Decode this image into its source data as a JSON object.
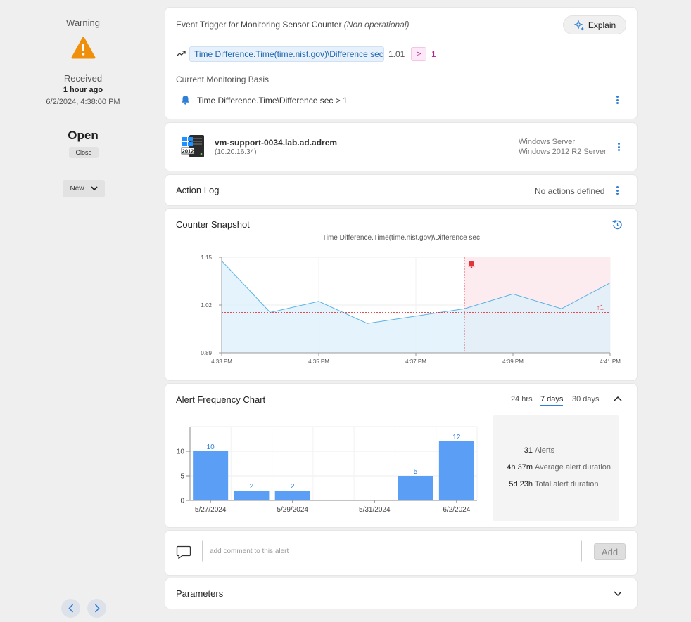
{
  "status": {
    "severity": "Warning",
    "received_label": "Received",
    "received_ago": "1 hour ago",
    "received_datetime": "6/2/2024, 4:38:00 PM",
    "state": "Open",
    "close_label": "Close",
    "new_dropdown": "New"
  },
  "trigger": {
    "title": "Event Trigger for Monitoring Sensor Counter",
    "title_note": "(Non operational)",
    "explain_label": "Explain",
    "counter": "Time Difference.Time(time.nist.gov)\\Difference sec",
    "value": "1.01",
    "operator": ">",
    "threshold": "1",
    "basis_label": "Current Monitoring Basis",
    "basis_rule": "Time Difference.Time\\Difference sec > 1"
  },
  "device": {
    "name": "vm-support-0034.lab.ad.adrem",
    "ip": "(10.20.16.34)",
    "os_line1": "Windows Server",
    "os_line2": "Windows 2012 R2 Server",
    "icon_badge": "2012"
  },
  "action_log": {
    "title": "Action Log",
    "status": "No actions defined"
  },
  "snapshot": {
    "title": "Counter Snapshot",
    "chart_title": "Time Difference.Time(time.nist.gov)\\Difference sec",
    "threshold_marker": "↑1"
  },
  "frequency": {
    "title": "Alert Frequency Chart",
    "tabs": [
      "24 hrs",
      "7 days",
      "30 days"
    ],
    "active_tab": 1,
    "stats": [
      {
        "value": "31",
        "label": "Alerts"
      },
      {
        "value": "4h 37m",
        "label": "Average alert duration"
      },
      {
        "value": "5d 23h",
        "label": "Total alert duration"
      }
    ]
  },
  "comment": {
    "placeholder": "add comment to this alert",
    "add_label": "Add"
  },
  "parameters": {
    "title": "Parameters"
  },
  "colors": {
    "accent": "#2f7fd6",
    "warning": "#f0900a",
    "alert_red": "#e0353b",
    "bar": "#5a9ef6",
    "line": "#5ab2e6"
  },
  "chart_data": [
    {
      "type": "area",
      "title": "Time Difference.Time(time.nist.gov)\\Difference sec",
      "x": [
        "4:33 PM",
        "4:34 PM",
        "4:35 PM",
        "4:36 PM",
        "4:37 PM",
        "4:38 PM",
        "4:39 PM",
        "4:40 PM",
        "4:41 PM"
      ],
      "xticks": [
        "4:33 PM",
        "4:35 PM",
        "4:37 PM",
        "4:39 PM",
        "4:41 PM"
      ],
      "values": [
        1.14,
        1.0,
        1.03,
        0.97,
        0.99,
        1.01,
        1.05,
        1.01,
        1.08
      ],
      "ylim": [
        0.89,
        1.15
      ],
      "yticks": [
        "0.89",
        "1.02",
        "1.15"
      ],
      "threshold": 1,
      "alert_start": "4:38 PM",
      "grid": true
    },
    {
      "type": "bar",
      "categories": [
        "5/27/2024",
        "5/28/2024",
        "5/29/2024",
        "5/30/2024",
        "5/31/2024",
        "6/1/2024",
        "6/2/2024"
      ],
      "xticks": [
        "5/27/2024",
        "5/29/2024",
        "5/31/2024",
        "6/2/2024"
      ],
      "values": [
        10,
        2,
        2,
        0,
        0,
        5,
        12
      ],
      "yticks": [
        "0",
        "5",
        "10"
      ],
      "ylim": [
        0,
        15
      ],
      "grid": true
    }
  ]
}
